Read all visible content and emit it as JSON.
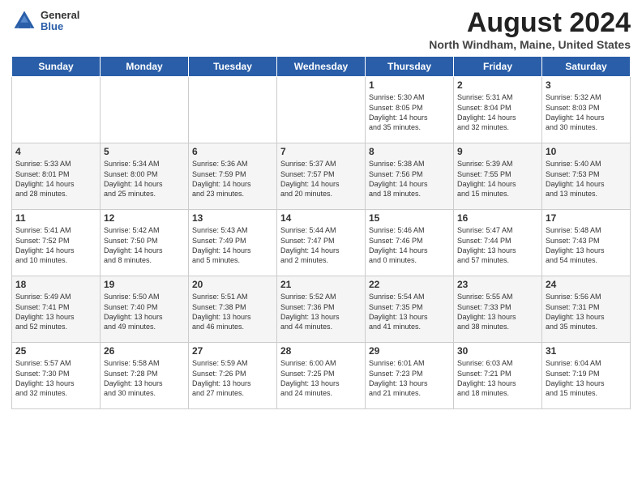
{
  "logo": {
    "general": "General",
    "blue": "Blue"
  },
  "title": "August 2024",
  "location": "North Windham, Maine, United States",
  "weekdays": [
    "Sunday",
    "Monday",
    "Tuesday",
    "Wednesday",
    "Thursday",
    "Friday",
    "Saturday"
  ],
  "weeks": [
    [
      {
        "day": "",
        "text": ""
      },
      {
        "day": "",
        "text": ""
      },
      {
        "day": "",
        "text": ""
      },
      {
        "day": "",
        "text": ""
      },
      {
        "day": "1",
        "text": "Sunrise: 5:30 AM\nSunset: 8:05 PM\nDaylight: 14 hours\nand 35 minutes."
      },
      {
        "day": "2",
        "text": "Sunrise: 5:31 AM\nSunset: 8:04 PM\nDaylight: 14 hours\nand 32 minutes."
      },
      {
        "day": "3",
        "text": "Sunrise: 5:32 AM\nSunset: 8:03 PM\nDaylight: 14 hours\nand 30 minutes."
      }
    ],
    [
      {
        "day": "4",
        "text": "Sunrise: 5:33 AM\nSunset: 8:01 PM\nDaylight: 14 hours\nand 28 minutes."
      },
      {
        "day": "5",
        "text": "Sunrise: 5:34 AM\nSunset: 8:00 PM\nDaylight: 14 hours\nand 25 minutes."
      },
      {
        "day": "6",
        "text": "Sunrise: 5:36 AM\nSunset: 7:59 PM\nDaylight: 14 hours\nand 23 minutes."
      },
      {
        "day": "7",
        "text": "Sunrise: 5:37 AM\nSunset: 7:57 PM\nDaylight: 14 hours\nand 20 minutes."
      },
      {
        "day": "8",
        "text": "Sunrise: 5:38 AM\nSunset: 7:56 PM\nDaylight: 14 hours\nand 18 minutes."
      },
      {
        "day": "9",
        "text": "Sunrise: 5:39 AM\nSunset: 7:55 PM\nDaylight: 14 hours\nand 15 minutes."
      },
      {
        "day": "10",
        "text": "Sunrise: 5:40 AM\nSunset: 7:53 PM\nDaylight: 14 hours\nand 13 minutes."
      }
    ],
    [
      {
        "day": "11",
        "text": "Sunrise: 5:41 AM\nSunset: 7:52 PM\nDaylight: 14 hours\nand 10 minutes."
      },
      {
        "day": "12",
        "text": "Sunrise: 5:42 AM\nSunset: 7:50 PM\nDaylight: 14 hours\nand 8 minutes."
      },
      {
        "day": "13",
        "text": "Sunrise: 5:43 AM\nSunset: 7:49 PM\nDaylight: 14 hours\nand 5 minutes."
      },
      {
        "day": "14",
        "text": "Sunrise: 5:44 AM\nSunset: 7:47 PM\nDaylight: 14 hours\nand 2 minutes."
      },
      {
        "day": "15",
        "text": "Sunrise: 5:46 AM\nSunset: 7:46 PM\nDaylight: 14 hours\nand 0 minutes."
      },
      {
        "day": "16",
        "text": "Sunrise: 5:47 AM\nSunset: 7:44 PM\nDaylight: 13 hours\nand 57 minutes."
      },
      {
        "day": "17",
        "text": "Sunrise: 5:48 AM\nSunset: 7:43 PM\nDaylight: 13 hours\nand 54 minutes."
      }
    ],
    [
      {
        "day": "18",
        "text": "Sunrise: 5:49 AM\nSunset: 7:41 PM\nDaylight: 13 hours\nand 52 minutes."
      },
      {
        "day": "19",
        "text": "Sunrise: 5:50 AM\nSunset: 7:40 PM\nDaylight: 13 hours\nand 49 minutes."
      },
      {
        "day": "20",
        "text": "Sunrise: 5:51 AM\nSunset: 7:38 PM\nDaylight: 13 hours\nand 46 minutes."
      },
      {
        "day": "21",
        "text": "Sunrise: 5:52 AM\nSunset: 7:36 PM\nDaylight: 13 hours\nand 44 minutes."
      },
      {
        "day": "22",
        "text": "Sunrise: 5:54 AM\nSunset: 7:35 PM\nDaylight: 13 hours\nand 41 minutes."
      },
      {
        "day": "23",
        "text": "Sunrise: 5:55 AM\nSunset: 7:33 PM\nDaylight: 13 hours\nand 38 minutes."
      },
      {
        "day": "24",
        "text": "Sunrise: 5:56 AM\nSunset: 7:31 PM\nDaylight: 13 hours\nand 35 minutes."
      }
    ],
    [
      {
        "day": "25",
        "text": "Sunrise: 5:57 AM\nSunset: 7:30 PM\nDaylight: 13 hours\nand 32 minutes."
      },
      {
        "day": "26",
        "text": "Sunrise: 5:58 AM\nSunset: 7:28 PM\nDaylight: 13 hours\nand 30 minutes."
      },
      {
        "day": "27",
        "text": "Sunrise: 5:59 AM\nSunset: 7:26 PM\nDaylight: 13 hours\nand 27 minutes."
      },
      {
        "day": "28",
        "text": "Sunrise: 6:00 AM\nSunset: 7:25 PM\nDaylight: 13 hours\nand 24 minutes."
      },
      {
        "day": "29",
        "text": "Sunrise: 6:01 AM\nSunset: 7:23 PM\nDaylight: 13 hours\nand 21 minutes."
      },
      {
        "day": "30",
        "text": "Sunrise: 6:03 AM\nSunset: 7:21 PM\nDaylight: 13 hours\nand 18 minutes."
      },
      {
        "day": "31",
        "text": "Sunrise: 6:04 AM\nSunset: 7:19 PM\nDaylight: 13 hours\nand 15 minutes."
      }
    ]
  ]
}
